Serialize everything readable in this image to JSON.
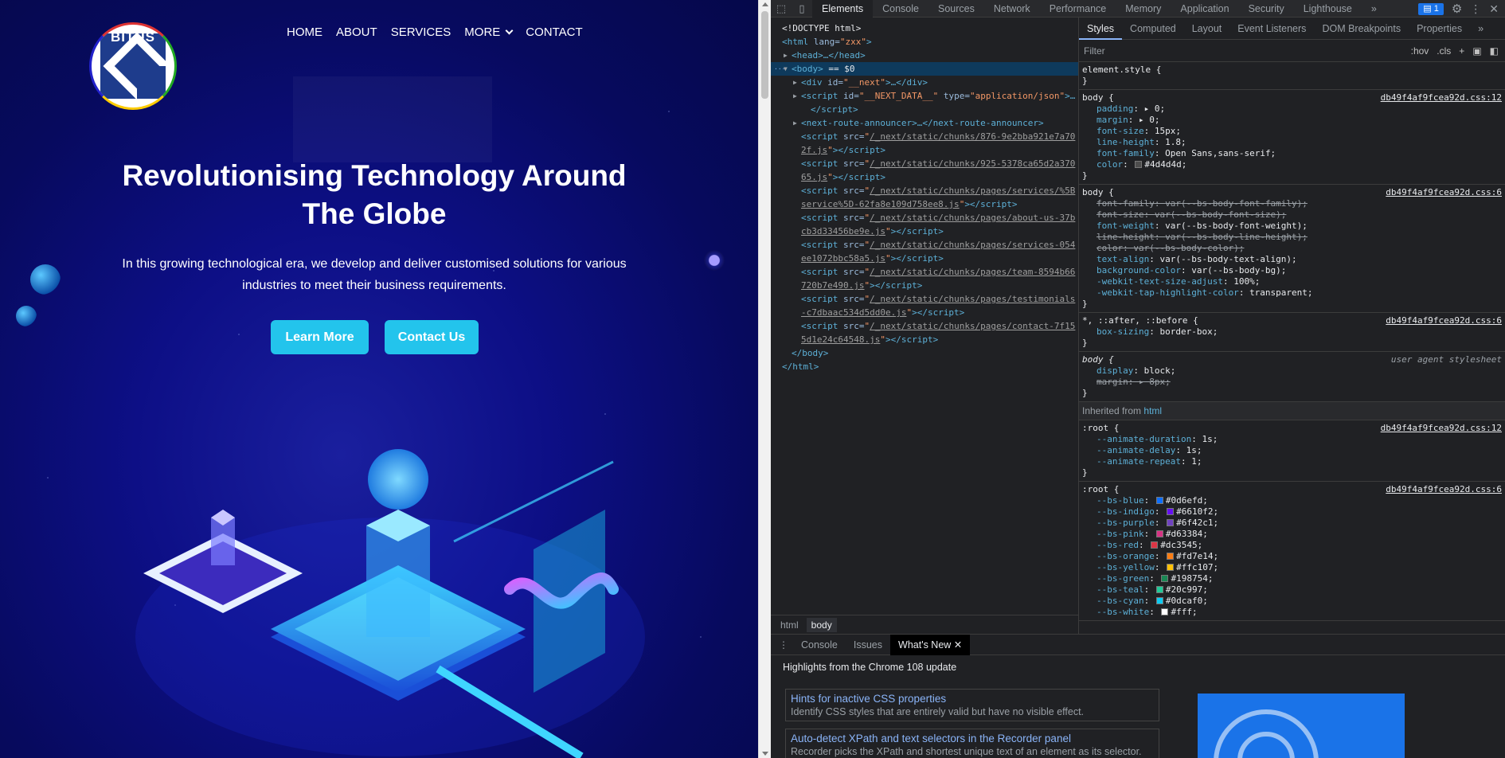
{
  "site": {
    "logo_text": "BITUS",
    "nav": [
      "HOME",
      "ABOUT",
      "SERVICES",
      "MORE",
      "CONTACT"
    ],
    "hero_title": "Revolutionising Technology Around The Globe",
    "hero_subtitle": "In this growing technological era, we develop and deliver customised solutions for various industries to meet their business requirements.",
    "buttons": {
      "learn_more": "Learn More",
      "contact_us": "Contact Us"
    },
    "colors": {
      "background": "#0a0d78",
      "button": "#23c4ec"
    }
  },
  "devtools": {
    "tabs": [
      "Elements",
      "Console",
      "Sources",
      "Network",
      "Performance",
      "Memory",
      "Application",
      "Security",
      "Lighthouse"
    ],
    "active_tab": "Elements",
    "more_tabs": "»",
    "issues_badge": "1",
    "dom": {
      "doctype": "<!DOCTYPE html>",
      "html_tag": "html",
      "html_lang_attr": "lang",
      "html_lang_val": "\"zxx\"",
      "head": "<head>…</head>",
      "body_open": "<body>",
      "body_marker": "== $0",
      "next_div_attr": "id=",
      "next_div_val": "\"__next\"",
      "next_data_attr": "id=",
      "next_data_val": "\"__NEXT_DATA__\"",
      "next_data_type_attr": "type=",
      "next_data_type_val": "\"application/json\"",
      "route_announcer": "<next-route-announcer>…</next-route-announcer>",
      "scripts": [
        [
          "/_next/static/chunks/876-9e2bba921e7a70",
          "2f.js"
        ],
        [
          "/_next/static/chunks/925-5378ca65d2a370",
          "65.js"
        ],
        [
          "/_next/static/chunks/pages/services/%5B",
          "service%5D-62fa8e109d758ee8.js"
        ],
        [
          "/_next/static/chunks/pages/about-us-37b",
          "cb3d33456be9e.js"
        ],
        [
          "/_next/static/chunks/pages/services-054",
          "ee1072bbc58a5.js"
        ],
        [
          "/_next/static/chunks/pages/team-8594b66",
          "720b7e490.js"
        ],
        [
          "/_next/static/chunks/pages/testimonials",
          "-c7dbaac534d5dd0e.js"
        ],
        [
          "/_next/static/chunks/pages/contact-7f15",
          "5d1e24c64548.js"
        ]
      ],
      "body_close": "</body>",
      "html_close": "</html>"
    },
    "breadcrumbs": [
      "html",
      "body"
    ],
    "styles_tabs": [
      "Styles",
      "Computed",
      "Layout",
      "Event Listeners",
      "DOM Breakpoints",
      "Properties"
    ],
    "filter_placeholder": "Filter",
    "filter_tools": [
      ":hov",
      ".cls",
      "+"
    ],
    "rules": {
      "element_style": "element.style {",
      "body1_selector": "body {",
      "body1_source": "db49f4af9fcea92d.css:12",
      "body1_decls": [
        [
          "padding",
          "▸ 0;"
        ],
        [
          "margin",
          "▸ 0;"
        ],
        [
          "font-size",
          "15px;"
        ],
        [
          "line-height",
          "1.8;"
        ],
        [
          "font-family",
          "Open Sans,sans-serif;"
        ],
        [
          "color",
          "#4d4d4d;"
        ]
      ],
      "body2_selector": "body {",
      "body2_source": "db49f4af9fcea92d.css:6",
      "body2_decls": [
        [
          "font-family",
          "var(--bs-body-font-family);",
          "s"
        ],
        [
          "font-size",
          "var(--bs-body-font-size);",
          "s"
        ],
        [
          "font-weight",
          "var(--bs-body-font-weight);",
          ""
        ],
        [
          "line-height",
          "var(--bs-body-line-height);",
          "s"
        ],
        [
          "color",
          "var(--bs-body-color);",
          "s"
        ],
        [
          "text-align",
          "var(--bs-body-text-align);",
          ""
        ],
        [
          "background-color",
          "var(--bs-body-bg);",
          ""
        ],
        [
          "-webkit-text-size-adjust",
          "100%;",
          ""
        ],
        [
          "-webkit-tap-highlight-color",
          "transparent;",
          ""
        ]
      ],
      "universal_selector": "*, ::after, ::before {",
      "universal_source": "db49f4af9fcea92d.css:6",
      "universal_decl": [
        "box-sizing",
        "border-box;"
      ],
      "ua_selector": "body {",
      "ua_source": "user agent stylesheet",
      "ua_decls": [
        [
          "display",
          "block;",
          ""
        ],
        [
          "margin",
          "▸ 8px;",
          "s"
        ]
      ],
      "inherited_label": "Inherited from",
      "inherited_from": "html",
      "root1_selector": ":root {",
      "root1_source": "db49f4af9fcea92d.css:12",
      "root1_decls": [
        [
          "--animate-duration",
          "1s;"
        ],
        [
          "--animate-delay",
          "1s;"
        ],
        [
          "--animate-repeat",
          "1;"
        ]
      ],
      "root2_selector": ":root {",
      "root2_source": "db49f4af9fcea92d.css:6",
      "root2_decls": [
        [
          "--bs-blue",
          "#0d6efd;",
          "#0d6efd"
        ],
        [
          "--bs-indigo",
          "#6610f2;",
          "#6610f2"
        ],
        [
          "--bs-purple",
          "#6f42c1;",
          "#6f42c1"
        ],
        [
          "--bs-pink",
          "#d63384;",
          "#d63384"
        ],
        [
          "--bs-red",
          "#dc3545;",
          "#dc3545"
        ],
        [
          "--bs-orange",
          "#fd7e14;",
          "#fd7e14"
        ],
        [
          "--bs-yellow",
          "#ffc107;",
          "#ffc107"
        ],
        [
          "--bs-green",
          "#198754;",
          "#198754"
        ],
        [
          "--bs-teal",
          "#20c997;",
          "#20c997"
        ],
        [
          "--bs-cyan",
          "#0dcaf0;",
          "#0dcaf0"
        ],
        [
          "--bs-white",
          "#fff;",
          "#ffffff"
        ]
      ]
    },
    "drawer": {
      "tabs": [
        "Console",
        "Issues",
        "What's New"
      ],
      "active": "What's New",
      "heading": "Highlights from the Chrome 108 update",
      "cards": [
        {
          "title": "Hints for inactive CSS properties",
          "desc": "Identify CSS styles that are entirely valid but have no visible effect."
        },
        {
          "title": "Auto-detect XPath and text selectors in the Recorder panel",
          "desc": "Recorder picks the XPath and shortest unique text of an element as its selector."
        }
      ]
    }
  }
}
